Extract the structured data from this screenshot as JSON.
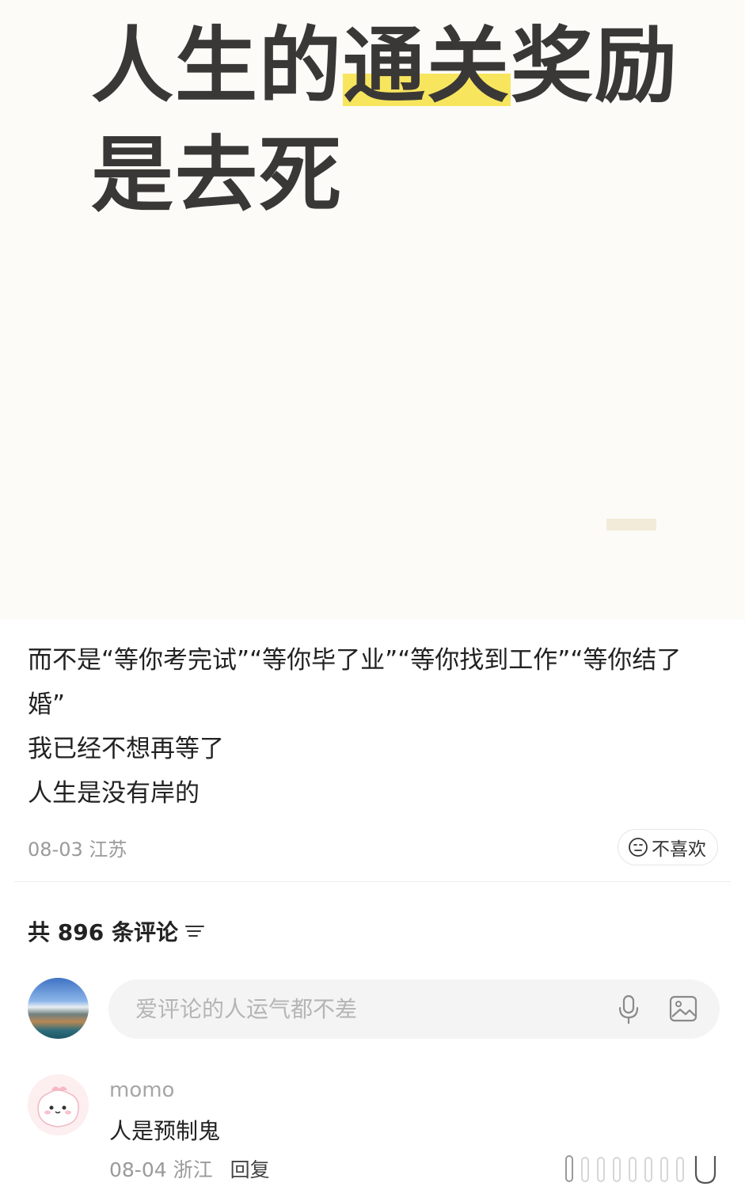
{
  "hero": {
    "title_line1_pre": "人生的",
    "title_line1_highlight": "通关",
    "title_line1_post": "奖励",
    "title_line2": "是去死",
    "highlight_color": "#f7e55e"
  },
  "post": {
    "lines": [
      "而不是“等你考完试”“等你毕了业”“等你找到工作”“等你结了婚”",
      "我已经不想再等了",
      "人生是没有岸的"
    ],
    "date": "08-03",
    "location": "江苏",
    "dislike_label": "不喜欢"
  },
  "comments": {
    "header": "共 896 条评论",
    "input_placeholder": "爱评论的人运气都不差",
    "items": [
      {
        "author": "momo",
        "text": "人是预制鬼",
        "date": "08-04",
        "location": "浙江",
        "reply_label": "回复"
      }
    ]
  },
  "icons": {
    "dislike": "neutral-face-icon",
    "sort": "sort-lines-icon",
    "mic": "microphone-icon",
    "image": "image-icon"
  }
}
